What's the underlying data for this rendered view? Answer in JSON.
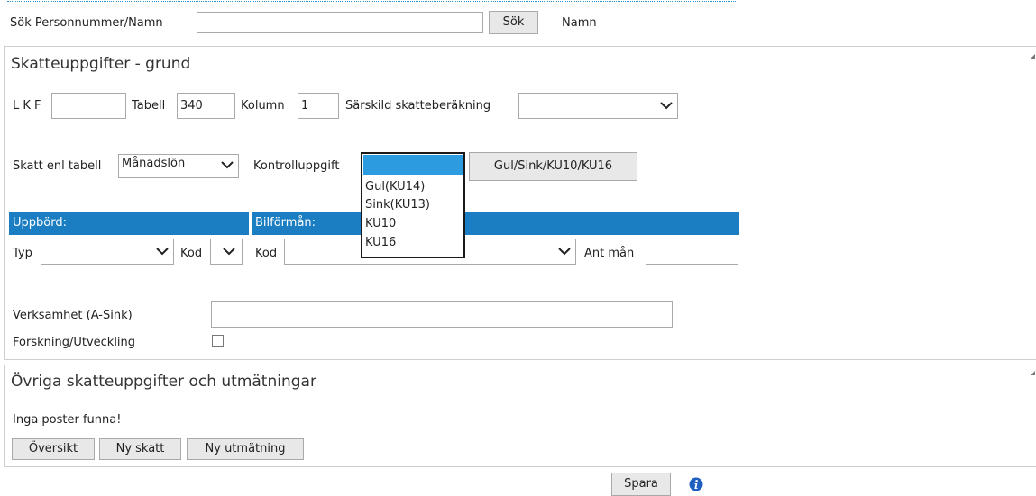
{
  "search": {
    "label": "Sök Personnummer/Namn",
    "value": "",
    "button": "Sök",
    "name_label": "Namn"
  },
  "grund": {
    "title": "Skatteuppgifter - grund",
    "lkf_label": "L K F",
    "lkf_value": "",
    "tabell_label": "Tabell",
    "tabell_value": "340",
    "kolumn_label": "Kolumn",
    "kolumn_value": "1",
    "sarskild_label": "Särskild skatteberäkning",
    "sarskild_value": "",
    "skatt_label": "Skatt enl tabell",
    "skatt_value": "Månadslön",
    "kontroll_label": "Kontrolluppgift",
    "kontroll_value": "",
    "kontroll_options": [
      "Gul(KU14)",
      "Sink(KU13)",
      "KU10",
      "KU16"
    ],
    "gul_button": "Gul/Sink/KU10/KU16",
    "uppbord_header": "Uppbörd:",
    "bilformon_header": "Bilförmån:",
    "typ_label": "Typ",
    "typ_value": "",
    "kod_label": "Kod",
    "kod_value": "",
    "bil_kod_label": "Kod",
    "bil_kod_value": "",
    "ant_man_label": "Ant mån",
    "ant_man_value": "",
    "verksamhet_label": "Verksamhet (A-Sink)",
    "verksamhet_value": "",
    "forskning_label": "Forskning/Utveckling",
    "forskning_checked": false
  },
  "ovriga": {
    "title": "Övriga skatteuppgifter och utmätningar",
    "empty_text": "Inga poster funna!",
    "oversikt_button": "Översikt",
    "ny_skatt_button": "Ny skatt",
    "ny_utmatning_button": "Ny utmätning"
  },
  "footer": {
    "spara_button": "Spara",
    "info_icon": "info-icon"
  },
  "colors": {
    "header_bar": "#1b7ec2",
    "dropdown_highlight": "#2d9be0"
  }
}
